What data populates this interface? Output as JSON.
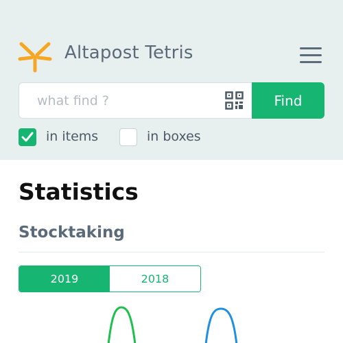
{
  "header": {
    "brand": "Altapost Tetris",
    "logo_icon": "asterisk-logo-icon",
    "menu_icon": "hamburger-menu-icon",
    "accent_color": "#f5a623"
  },
  "search": {
    "placeholder": "what find ?",
    "value": "",
    "scan_icon": "qr-code-icon",
    "button_label": "Find",
    "button_color": "#16b672"
  },
  "filters": [
    {
      "label": "in items",
      "checked": true
    },
    {
      "label": "in boxes",
      "checked": false
    }
  ],
  "page": {
    "title": "Statistics",
    "section_title": "Stocktaking"
  },
  "year_tabs": [
    {
      "label": "2019",
      "active": true
    },
    {
      "label": "2018",
      "active": false
    }
  ],
  "chart_data": {
    "type": "line",
    "title": "",
    "series": [
      {
        "color": "#1cc04a"
      },
      {
        "color": "#1f8fe0"
      }
    ]
  }
}
